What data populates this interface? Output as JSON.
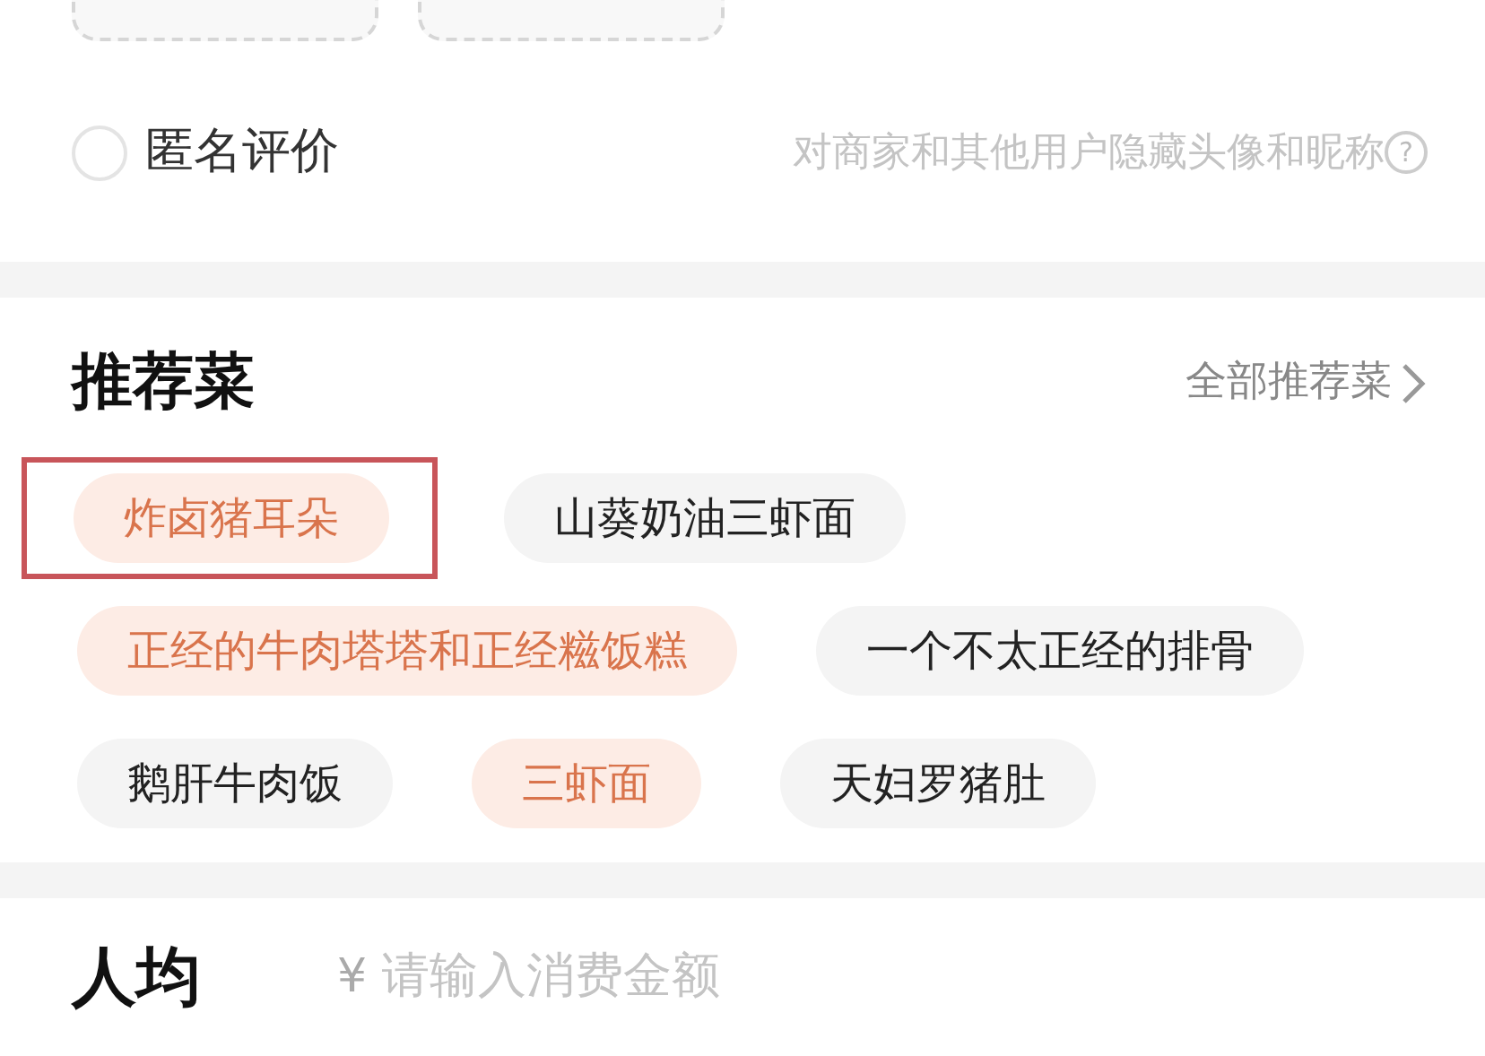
{
  "upload_slots": [
    {
      "kind": "slot"
    },
    {
      "kind": "slot"
    }
  ],
  "anonymous": {
    "label": "匿名评价",
    "checked": false,
    "hint": "对商家和其他用户隐藏头像和昵称",
    "help_icon": "?"
  },
  "recommended": {
    "title": "推荐菜",
    "link": "全部推荐菜",
    "dishes": [
      {
        "name": "炸卤猪耳朵",
        "selected": true,
        "highlighted": true
      },
      {
        "name": "山葵奶油三虾面",
        "selected": false,
        "highlighted": false
      },
      {
        "name": "正经的牛肉塔塔和正经糍饭糕",
        "selected": true,
        "highlighted": false
      },
      {
        "name": "一个不太正经的排骨",
        "selected": false,
        "highlighted": false
      },
      {
        "name": "鹅肝牛肉饭",
        "selected": false,
        "highlighted": false
      },
      {
        "name": "三虾面",
        "selected": true,
        "highlighted": false
      },
      {
        "name": "天妇罗猪肚",
        "selected": false,
        "highlighted": false
      }
    ]
  },
  "per_person": {
    "label": "人均",
    "currency": "¥",
    "placeholder": "请输入消费金额"
  }
}
